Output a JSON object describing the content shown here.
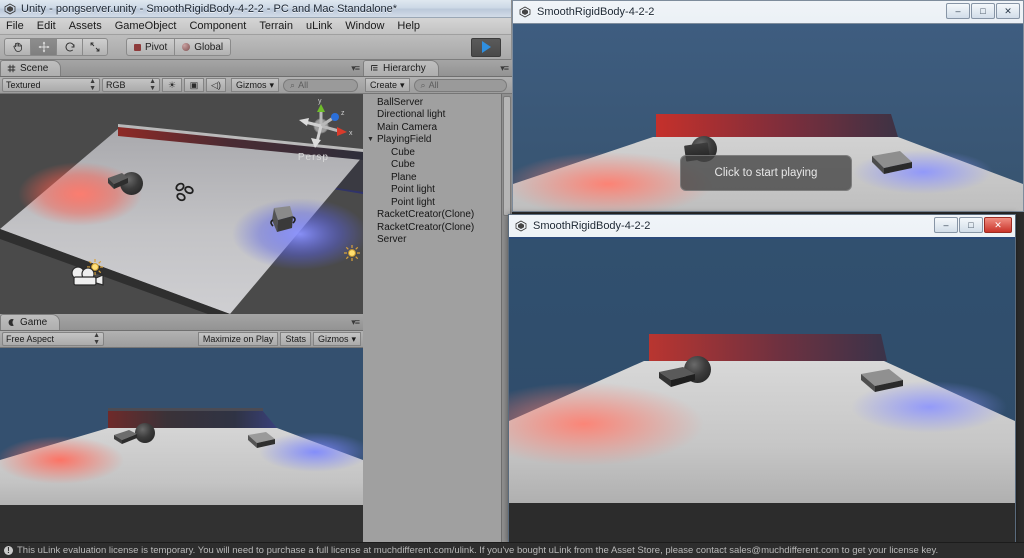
{
  "unity_editor": {
    "title": "Unity - pongserver.unity - SmoothRigidBody-4-2-2 - PC and Mac Standalone*",
    "logo_icon": "unity-logo-icon",
    "menu": [
      "File",
      "Edit",
      "Assets",
      "GameObject",
      "Component",
      "Terrain",
      "uLink",
      "Window",
      "Help"
    ],
    "toolbar": {
      "tools": [
        {
          "name": "hand-tool",
          "icon": "hand-icon",
          "active": false
        },
        {
          "name": "move-tool",
          "icon": "move-arrows-icon",
          "active": true
        },
        {
          "name": "rotate-tool",
          "icon": "rotate-icon",
          "active": false
        },
        {
          "name": "scale-tool",
          "icon": "scale-icon",
          "active": false
        }
      ],
      "pivot_label": "Pivot",
      "global_label": "Global",
      "play_icon": "play-triangle-icon",
      "play_active": true,
      "play_color": "#2f8fe0"
    },
    "scene_panel": {
      "tab_label": "Scene",
      "tab_icon": "scene-grid-icon",
      "draw_mode": "Textured",
      "color_mode": "RGB",
      "lighting_icon": "sun-icon",
      "fx_icon": "image-icon",
      "audio_icon": "speaker-icon",
      "gizmos_label": "Gizmos",
      "search_placeholder": "All",
      "search_icon": "search-icon",
      "perspective_label": "Persp",
      "gizmo_axes": [
        "y",
        "z",
        "x"
      ],
      "axis_colors": {
        "x": "#d93b2b",
        "y": "#6fbd2a",
        "z": "#2b6fd9"
      }
    },
    "hierarchy_panel": {
      "tab_label": "Hierarchy",
      "tab_icon": "hierarchy-icon",
      "create_label": "Create",
      "search_placeholder": "All",
      "items": [
        {
          "label": "BallServer",
          "depth": 0,
          "expandable": false
        },
        {
          "label": "Directional light",
          "depth": 0,
          "expandable": false
        },
        {
          "label": "Main Camera",
          "depth": 0,
          "expandable": false
        },
        {
          "label": "PlayingField",
          "depth": 0,
          "expandable": true,
          "expanded": true
        },
        {
          "label": "Cube",
          "depth": 1,
          "expandable": false
        },
        {
          "label": "Cube",
          "depth": 1,
          "expandable": false
        },
        {
          "label": "Plane",
          "depth": 1,
          "expandable": false
        },
        {
          "label": "Point light",
          "depth": 1,
          "expandable": false
        },
        {
          "label": "Point light",
          "depth": 1,
          "expandable": false
        },
        {
          "label": "RacketCreator(Clone)",
          "depth": 0,
          "expandable": false
        },
        {
          "label": "RacketCreator(Clone)",
          "depth": 0,
          "expandable": false
        },
        {
          "label": "Server",
          "depth": 0,
          "expandable": false
        }
      ]
    },
    "game_panel": {
      "tab_label": "Game",
      "tab_icon": "game-icon",
      "aspect": "Free Aspect",
      "maximize_label": "Maximize on Play",
      "stats_label": "Stats",
      "gizmos_label": "Gizmos"
    },
    "statusbar": {
      "warn_icon": "warning-icon",
      "message": "This uLink evaluation license is temporary. You will need to purchase a full license at muchdifferent.com/ulink. If you've bought uLink from the Asset Store, please contact sales@muchdifferent.com to get your license key."
    }
  },
  "player_windows": [
    {
      "title": "SmoothRigidBody-4-2-2",
      "icon": "unity-logo-icon",
      "active": false,
      "buttons": {
        "minimize": "–",
        "maximize": "□",
        "close": "✕"
      },
      "overlay_button": "Click to start playing",
      "sky_color": "#3b5878",
      "floor_color": "#c3c3c3",
      "wall_color": "#b8332e",
      "light_red": "#ff6b5e",
      "light_blue": "#6a78f0"
    },
    {
      "title": "SmoothRigidBody-4-2-2",
      "icon": "unity-logo-icon",
      "active": true,
      "buttons": {
        "minimize": "–",
        "maximize": "□",
        "close": "✕"
      },
      "overlay_button": null,
      "sky_color": "#345475",
      "floor_color": "#c5c5c5",
      "wall_color": "#b23a33",
      "light_red": "#ff6b5e",
      "light_blue": "#6a78f0"
    }
  ],
  "scene_objects": {
    "ball_label": "ball-sphere",
    "paddle_left_label": "racket-left",
    "paddle_right_label": "racket-right",
    "light_red_label": "point-light-red-gizmo",
    "light_blue_label": "point-light-blue-gizmo",
    "camera_gizmo_label": "main-camera-gizmo",
    "particle_gizmo_label": "ball-server-gizmo"
  }
}
